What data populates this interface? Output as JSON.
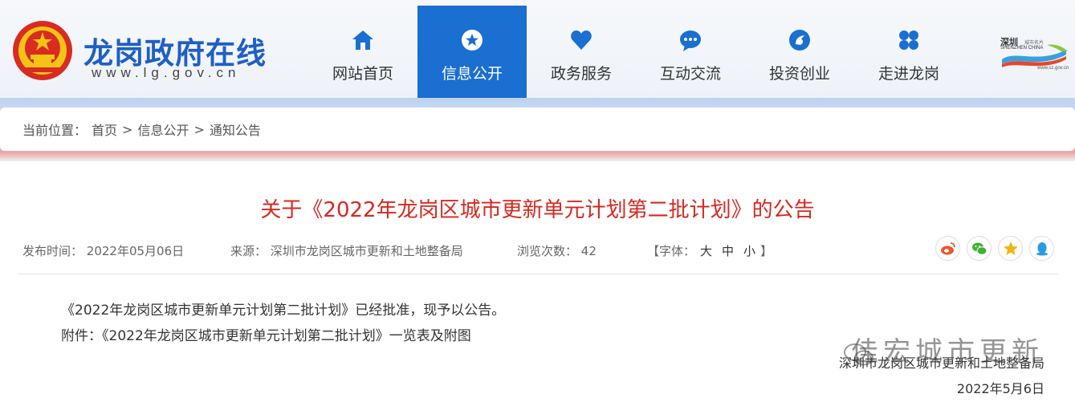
{
  "header": {
    "site_title": "龙岗政府在线",
    "site_url": "www.lg.gov.cn",
    "nav": [
      {
        "label": "网站首页",
        "icon": "home-icon",
        "active": false
      },
      {
        "label": "信息公开",
        "icon": "star-circle-icon",
        "active": true
      },
      {
        "label": "政务服务",
        "icon": "heart-icon",
        "active": false
      },
      {
        "label": "互动交流",
        "icon": "chat-icon",
        "active": false
      },
      {
        "label": "投资创业",
        "icon": "compass-icon",
        "active": false
      },
      {
        "label": "走进龙岗",
        "icon": "grid-icon",
        "active": false
      }
    ],
    "partner_logo_text": "SHENZHEN CHINA",
    "partner_logo_sub": "www.sz.gov.cn",
    "accent_color": "#1a6fd0"
  },
  "breadcrumb": {
    "prefix": "当前位置：",
    "items": [
      "首页",
      "信息公开",
      "通知公告"
    ],
    "separator": ">"
  },
  "article": {
    "title": "关于《2022年龙岗区城市更新单元计划第二批计划》的公告",
    "title_color": "#d6281f",
    "meta": {
      "publish_label": "发布时间：",
      "publish_date": "2022年05月06日",
      "source_label": "来源：",
      "source": "深圳市龙岗区城市更新和土地整备局",
      "views_label": "浏览次数：",
      "views": "42",
      "font_label_open": "【字体：",
      "font_large": "大",
      "font_medium": "中",
      "font_small": "小",
      "font_label_close": "】"
    },
    "share": [
      {
        "icon": "weibo-icon",
        "color": "#e8572c"
      },
      {
        "icon": "wechat-icon",
        "color": "#42b035"
      },
      {
        "icon": "qzone-star-icon",
        "color": "#f2b316"
      },
      {
        "icon": "qq-icon",
        "color": "#2a9be0"
      }
    ],
    "paragraph_1": "《2022年龙岗区城市更新单元计划第二批计划》已经批准，现予以公告。",
    "attachment_label": "附件：",
    "attachment": "《2022年龙岗区城市更新单元计划第二批计划》一览表及附图",
    "signature_org": "深圳市龙岗区城市更新和土地整备局",
    "signature_date": "2022年5月6日"
  },
  "watermark": {
    "text": "佳宏城市更新"
  }
}
